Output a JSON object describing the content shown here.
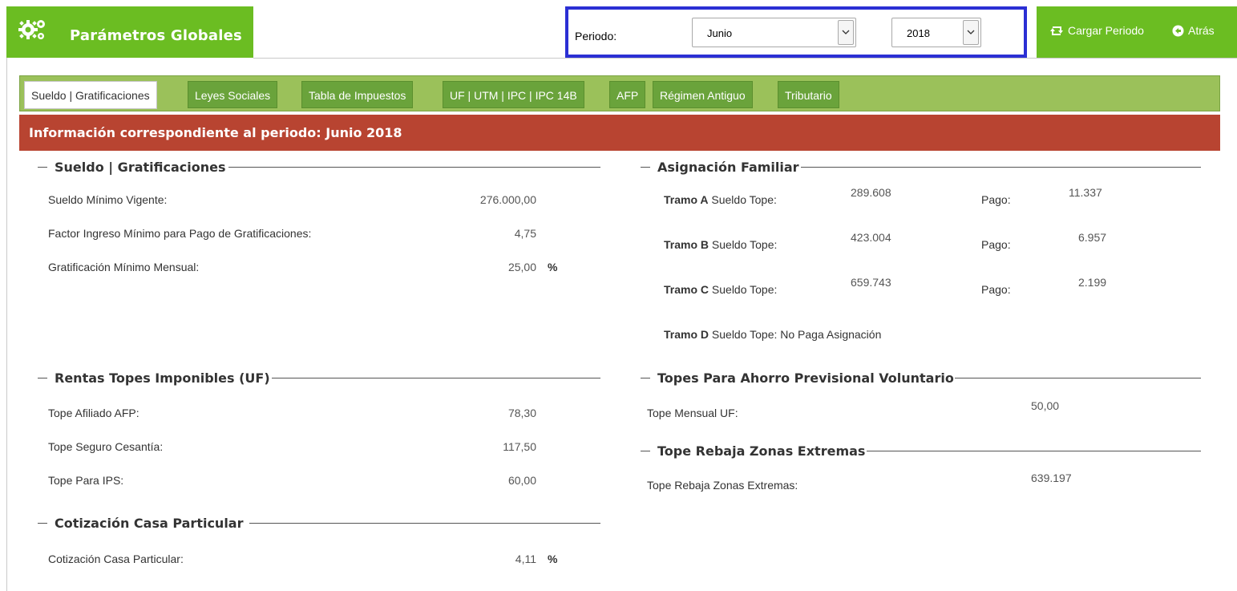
{
  "header": {
    "title": "Parámetros Globales",
    "periodo_label": "Periodo:",
    "month": "Junio",
    "year": "2018",
    "load_label": "Cargar Periodo",
    "back_label": "Atrás"
  },
  "tabs": [
    {
      "label": "Sueldo | Gratificaciones",
      "active": true
    },
    {
      "label": "Leyes Sociales"
    },
    {
      "label": "Tabla de Impuestos"
    },
    {
      "label": "UF | UTM | IPC | IPC 14B"
    },
    {
      "label": "AFP"
    },
    {
      "label": "Régimen Antiguo"
    },
    {
      "label": "Tributario"
    }
  ],
  "banner": "Información correspondiente al periodo: Junio 2018",
  "sueldo": {
    "legend": "Sueldo | Gratificaciones",
    "rows": [
      {
        "label": "Sueldo Mínimo Vigente:",
        "value": "276.000,00"
      },
      {
        "label": "Factor Ingreso Mínimo para Pago de Gratificaciones:",
        "value": "4,75"
      },
      {
        "label": "Gratificación Mínimo Mensual:",
        "value": "25,00",
        "unit": "%"
      }
    ]
  },
  "rentas": {
    "legend": "Rentas Topes Imponibles (UF)",
    "rows": [
      {
        "label": "Tope Afiliado AFP:",
        "value": "78,30"
      },
      {
        "label": "Tope Seguro Cesantía:",
        "value": "117,50"
      },
      {
        "label": "Tope Para IPS:",
        "value": "60,00"
      }
    ]
  },
  "casa": {
    "legend": "Cotización Casa Particular",
    "label": "Cotización Casa Particular:",
    "value": "4,11",
    "unit": "%"
  },
  "asignacion": {
    "legend": "Asignación Familiar",
    "tope_label": "Sueldo Tope:",
    "pago_label": "Pago:",
    "tramos": [
      {
        "name": "Tramo A",
        "tope": "289.608",
        "pago": "11.337"
      },
      {
        "name": "Tramo B",
        "tope": "423.004",
        "pago": "6.957"
      },
      {
        "name": "Tramo C",
        "tope": "659.743",
        "pago": "2.199"
      }
    ],
    "tramo_d_name": "Tramo D",
    "tramo_d_text": "Sueldo Tope: No Paga Asignación"
  },
  "apv": {
    "legend": "Topes Para Ahorro Previsional Voluntario",
    "label": "Tope Mensual UF:",
    "value": "50,00"
  },
  "zonas": {
    "legend": "Tope Rebaja Zonas Extremas",
    "label": "Tope Rebaja Zonas Extremas:",
    "value": "639.197"
  }
}
